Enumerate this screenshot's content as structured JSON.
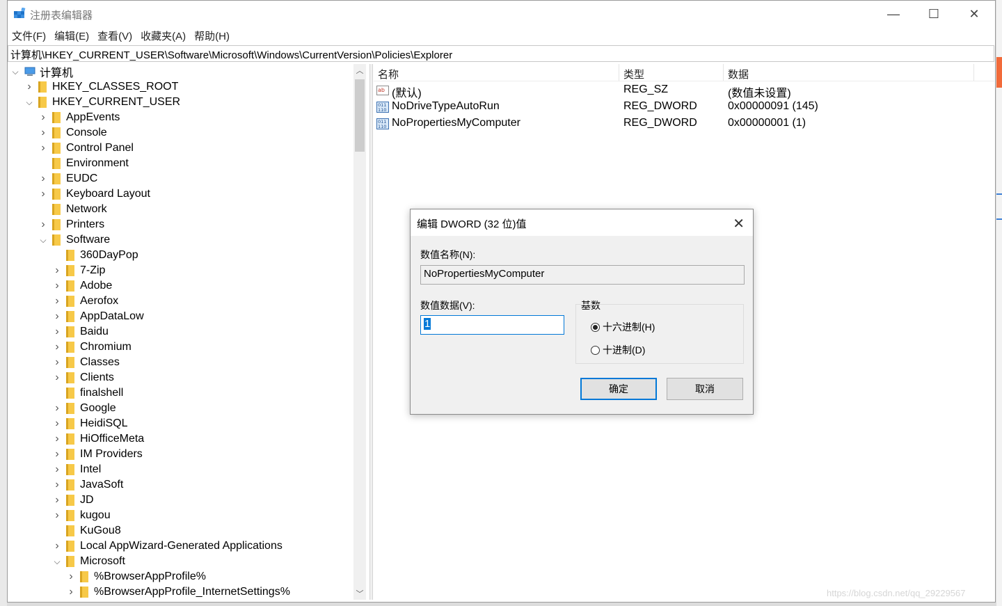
{
  "window": {
    "title": "注册表编辑器",
    "controls": {
      "minimize": "—",
      "maximize": "☐",
      "close": "✕"
    }
  },
  "menubar": {
    "items": [
      "文件(F)",
      "编辑(E)",
      "查看(V)",
      "收藏夹(A)",
      "帮助(H)"
    ]
  },
  "address": "计算机\\HKEY_CURRENT_USER\\Software\\Microsoft\\Windows\\CurrentVersion\\Policies\\Explorer",
  "tree": {
    "root": "计算机",
    "items": [
      {
        "label": "HKEY_CLASSES_ROOT",
        "level": 1,
        "expander": "closed"
      },
      {
        "label": "HKEY_CURRENT_USER",
        "level": 1,
        "expander": "open"
      },
      {
        "label": "AppEvents",
        "level": 2,
        "expander": "closed"
      },
      {
        "label": "Console",
        "level": 2,
        "expander": "closed"
      },
      {
        "label": "Control Panel",
        "level": 2,
        "expander": "closed"
      },
      {
        "label": "Environment",
        "level": 2,
        "expander": "none"
      },
      {
        "label": "EUDC",
        "level": 2,
        "expander": "closed"
      },
      {
        "label": "Keyboard Layout",
        "level": 2,
        "expander": "closed"
      },
      {
        "label": "Network",
        "level": 2,
        "expander": "none"
      },
      {
        "label": "Printers",
        "level": 2,
        "expander": "closed"
      },
      {
        "label": "Software",
        "level": 2,
        "expander": "open"
      },
      {
        "label": "360DayPop",
        "level": 3,
        "expander": "none"
      },
      {
        "label": "7-Zip",
        "level": 3,
        "expander": "closed"
      },
      {
        "label": "Adobe",
        "level": 3,
        "expander": "closed"
      },
      {
        "label": "Aerofox",
        "level": 3,
        "expander": "closed"
      },
      {
        "label": "AppDataLow",
        "level": 3,
        "expander": "closed"
      },
      {
        "label": "Baidu",
        "level": 3,
        "expander": "closed"
      },
      {
        "label": "Chromium",
        "level": 3,
        "expander": "closed"
      },
      {
        "label": "Classes",
        "level": 3,
        "expander": "closed"
      },
      {
        "label": "Clients",
        "level": 3,
        "expander": "closed"
      },
      {
        "label": "finalshell",
        "level": 3,
        "expander": "none"
      },
      {
        "label": "Google",
        "level": 3,
        "expander": "closed"
      },
      {
        "label": "HeidiSQL",
        "level": 3,
        "expander": "closed"
      },
      {
        "label": "HiOfficeMeta",
        "level": 3,
        "expander": "closed"
      },
      {
        "label": "IM Providers",
        "level": 3,
        "expander": "closed"
      },
      {
        "label": "Intel",
        "level": 3,
        "expander": "closed"
      },
      {
        "label": "JavaSoft",
        "level": 3,
        "expander": "closed"
      },
      {
        "label": "JD",
        "level": 3,
        "expander": "closed"
      },
      {
        "label": "kugou",
        "level": 3,
        "expander": "closed"
      },
      {
        "label": "KuGou8",
        "level": 3,
        "expander": "none"
      },
      {
        "label": "Local AppWizard-Generated Applications",
        "level": 3,
        "expander": "closed"
      },
      {
        "label": "Microsoft",
        "level": 3,
        "expander": "open"
      },
      {
        "label": "%BrowserAppProfile%",
        "level": 4,
        "expander": "closed"
      },
      {
        "label": "%BrowserAppProfile_InternetSettings%",
        "level": 4,
        "expander": "closed"
      }
    ]
  },
  "list": {
    "headers": {
      "name": "名称",
      "type": "类型",
      "data": "数据"
    },
    "rows": [
      {
        "icon": "string-value-icon",
        "name": "(默认)",
        "type": "REG_SZ",
        "data": "(数值未设置)"
      },
      {
        "icon": "binary-value-icon",
        "name": "NoDriveTypeAutoRun",
        "type": "REG_DWORD",
        "data": "0x00000091 (145)"
      },
      {
        "icon": "binary-value-icon",
        "name": "NoPropertiesMyComputer",
        "type": "REG_DWORD",
        "data": "0x00000001 (1)"
      }
    ]
  },
  "dialog": {
    "title": "编辑 DWORD (32 位)值",
    "close": "✕",
    "name_label": "数值名称(N):",
    "name_value": "NoPropertiesMyComputer",
    "data_label": "数值数据(V):",
    "data_value": "1",
    "base_label": "基数",
    "base_options": [
      {
        "label": "十六进制(H)",
        "selected": true
      },
      {
        "label": "十进制(D)",
        "selected": false
      }
    ],
    "ok": "确定",
    "cancel": "取消"
  },
  "watermark": "https://blog.csdn.net/qq_29229567"
}
